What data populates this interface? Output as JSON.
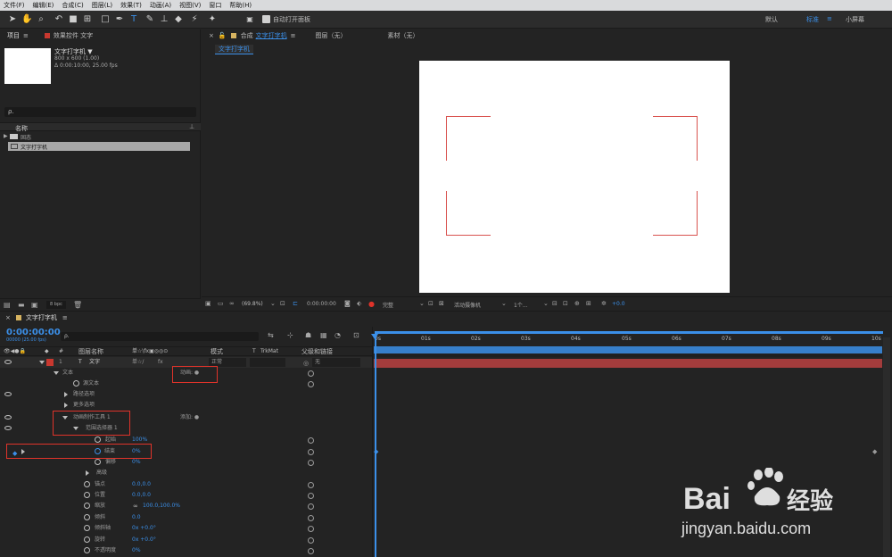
{
  "menu": [
    "文件(F)",
    "编辑(E)",
    "合成(C)",
    "图层(L)",
    "效果(T)",
    "动画(A)",
    "视图(V)",
    "窗口",
    "帮助(H)"
  ],
  "toolbar": {
    "auto_open_label": "自动打开面板",
    "workspaces": [
      "默认",
      "标准",
      "小屏幕"
    ]
  },
  "project": {
    "tab": "项目",
    "effects_tab": "效果控件 文字",
    "comp_name": "文字打字机 ▼",
    "comp_info1": "800 x 600 (1.00)",
    "comp_info2": "Δ 0:00:10:00, 25.00 fps",
    "search_placeholder": "ρ.",
    "col_name": "名称",
    "items": [
      "固态",
      "文字打字机"
    ],
    "bpc": "8 bpc"
  },
  "viewer": {
    "tab_prefix": "合成",
    "tab_comp": "文字打字机",
    "tab_layer": "图层（无）",
    "tab_footage": "素材（无）",
    "comp_chip": "文字打字机",
    "zoom": "(69.8%)",
    "timecode": "0:00:00:00",
    "quality": "完整",
    "camera": "活动摄像机",
    "views": "1个...",
    "exposure": "+0.0"
  },
  "timeline": {
    "tab": "文字打字机",
    "timecode": "0:00:00:00",
    "frames": "00000 (25.00 fps)",
    "search_placeholder": "ρ.",
    "headers": {
      "num": "#",
      "layer_name": "图层名称",
      "switches": "单☆\\fx▣◎◎⊙",
      "mode": "模式",
      "t": "T",
      "trkmat": "TrkMat",
      "parent": "父级和链接"
    },
    "layer": {
      "num": "1",
      "type": "T",
      "name": "文字",
      "switches": "单☆/",
      "fx": "fx",
      "mode": "正常",
      "parent": "无"
    },
    "rows": [
      {
        "name": "文本",
        "extra": "动画: ●"
      },
      {
        "name": "源文本",
        "value": ""
      },
      {
        "name": "路径选项",
        "value": ""
      },
      {
        "name": "更多选项",
        "value": ""
      },
      {
        "name": "动画制作工具 1",
        "extra": "添加: ●"
      },
      {
        "name": "范围选择器 1",
        "value": ""
      },
      {
        "name": "起始",
        "value": "100%"
      },
      {
        "name": "结束",
        "value": "0%"
      },
      {
        "name": "偏移",
        "value": "0%"
      },
      {
        "name": "高级",
        "value": ""
      },
      {
        "name": "锚点",
        "value": "0.0,0.0"
      },
      {
        "name": "位置",
        "value": "0.0,0.0"
      },
      {
        "name": "缩放",
        "value": "100.0,100.0%"
      },
      {
        "name": "倾斜",
        "value": "0.0"
      },
      {
        "name": "倾斜轴",
        "value": "0x +0.0°"
      },
      {
        "name": "旋转",
        "value": "0x +0.0°"
      },
      {
        "name": "不透明度",
        "value": "0%"
      }
    ],
    "ruler": [
      "0s",
      "01s",
      "02s",
      "03s",
      "04s",
      "05s",
      "06s",
      "07s",
      "08s",
      "09s",
      "10s"
    ]
  },
  "watermark": {
    "brand": "Bai 经验",
    "url": "jingyan.baidu.com"
  },
  "colors": {
    "accent": "#3b8fe8",
    "highlight": "#e0332a",
    "layer_bar": "#a33c3c"
  }
}
